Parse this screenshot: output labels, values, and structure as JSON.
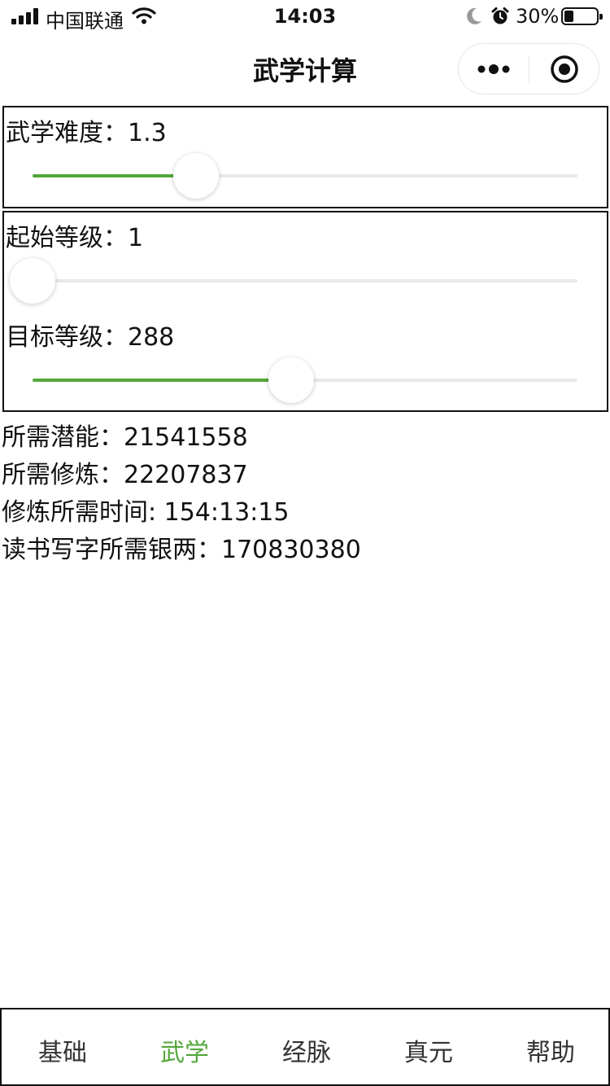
{
  "status_bar": {
    "carrier": "中国联通",
    "time": "14:03",
    "battery": "30%",
    "battery_level": 0.3
  },
  "nav": {
    "title": "武学计算",
    "more_icon": "more-dots-icon",
    "close_icon": "target-circle-icon"
  },
  "difficulty": {
    "label": "武学难度：",
    "value": "1.3",
    "slider_fraction": 0.3
  },
  "start_level": {
    "label": "起始等级：",
    "value": "1",
    "slider_fraction": 0.0
  },
  "target_level": {
    "label": "目标等级：",
    "value": "288",
    "slider_fraction": 0.475
  },
  "results": [
    {
      "label": "所需潜能：",
      "value": "21541558"
    },
    {
      "label": "所需修炼：",
      "value": "22207837"
    },
    {
      "label": "修炼所需时间: ",
      "value": "154:13:15"
    },
    {
      "label": "读书写字所需银两：",
      "value": "170830380"
    }
  ],
  "tabs": [
    {
      "label": "基础",
      "active": false
    },
    {
      "label": "武学",
      "active": true
    },
    {
      "label": "经脉",
      "active": false
    },
    {
      "label": "真元",
      "active": false
    },
    {
      "label": "帮助",
      "active": false
    }
  ],
  "colors": {
    "accent": "#53a73a",
    "track": "#e9e9e9",
    "text": "#111111"
  }
}
